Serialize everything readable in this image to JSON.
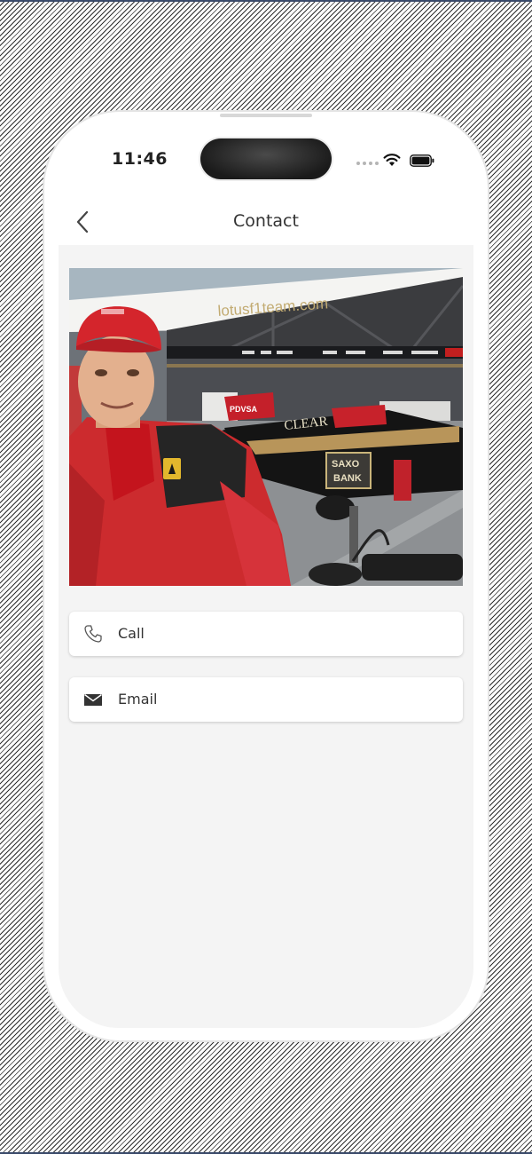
{
  "status_bar": {
    "time": "11:46"
  },
  "nav": {
    "title": "Contact"
  },
  "photo": {
    "sign_text": "lotusf1team.com",
    "sponsor_clear": "CLEAR",
    "sponsor_pdvsa": "PDVSA",
    "sponsor_saxo": "SAXO",
    "sponsor_bank": "BANK"
  },
  "actions": [
    {
      "label": "Call",
      "icon": "phone-icon"
    },
    {
      "label": "Email",
      "icon": "envelope-icon"
    }
  ]
}
